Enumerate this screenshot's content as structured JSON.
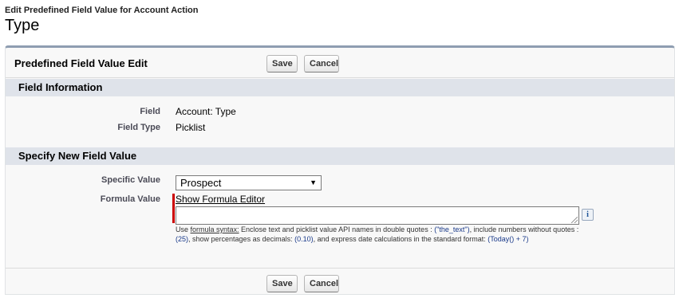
{
  "header": {
    "subtitle": "Edit Predefined Field Value for Account Action",
    "title": "Type"
  },
  "panel": {
    "title": "Predefined Field Value Edit",
    "save_label": "Save",
    "cancel_label": "Cancel"
  },
  "field_information": {
    "heading": "Field Information",
    "field_label": "Field",
    "field_value": "Account: Type",
    "field_type_label": "Field Type",
    "field_type_value": "Picklist"
  },
  "new_value": {
    "heading": "Specify New Field Value",
    "specific_value_label": "Specific Value",
    "specific_value_selected": "Prospect",
    "formula_value_label": "Formula Value",
    "formula_editor_link": "Show Formula Editor",
    "info_icon_glyph": "i",
    "help": {
      "prefix": "Use ",
      "syntax_link": "formula syntax:",
      "t1": " Enclose text and picklist value API names in double quotes : ",
      "c1": "(\"the_text\")",
      "t2": ", include numbers without quotes : ",
      "c2": "(25)",
      "t3": ", show percentages as decimals: ",
      "c3": "(0.10)",
      "t4": ", and express date calculations in the standard format: ",
      "c4": "(Today() + 7)"
    }
  },
  "colors": {
    "panel_border_top": "#8e9db1",
    "section_header_bg": "#dfe3ea",
    "required_bar": "#cc0000"
  }
}
